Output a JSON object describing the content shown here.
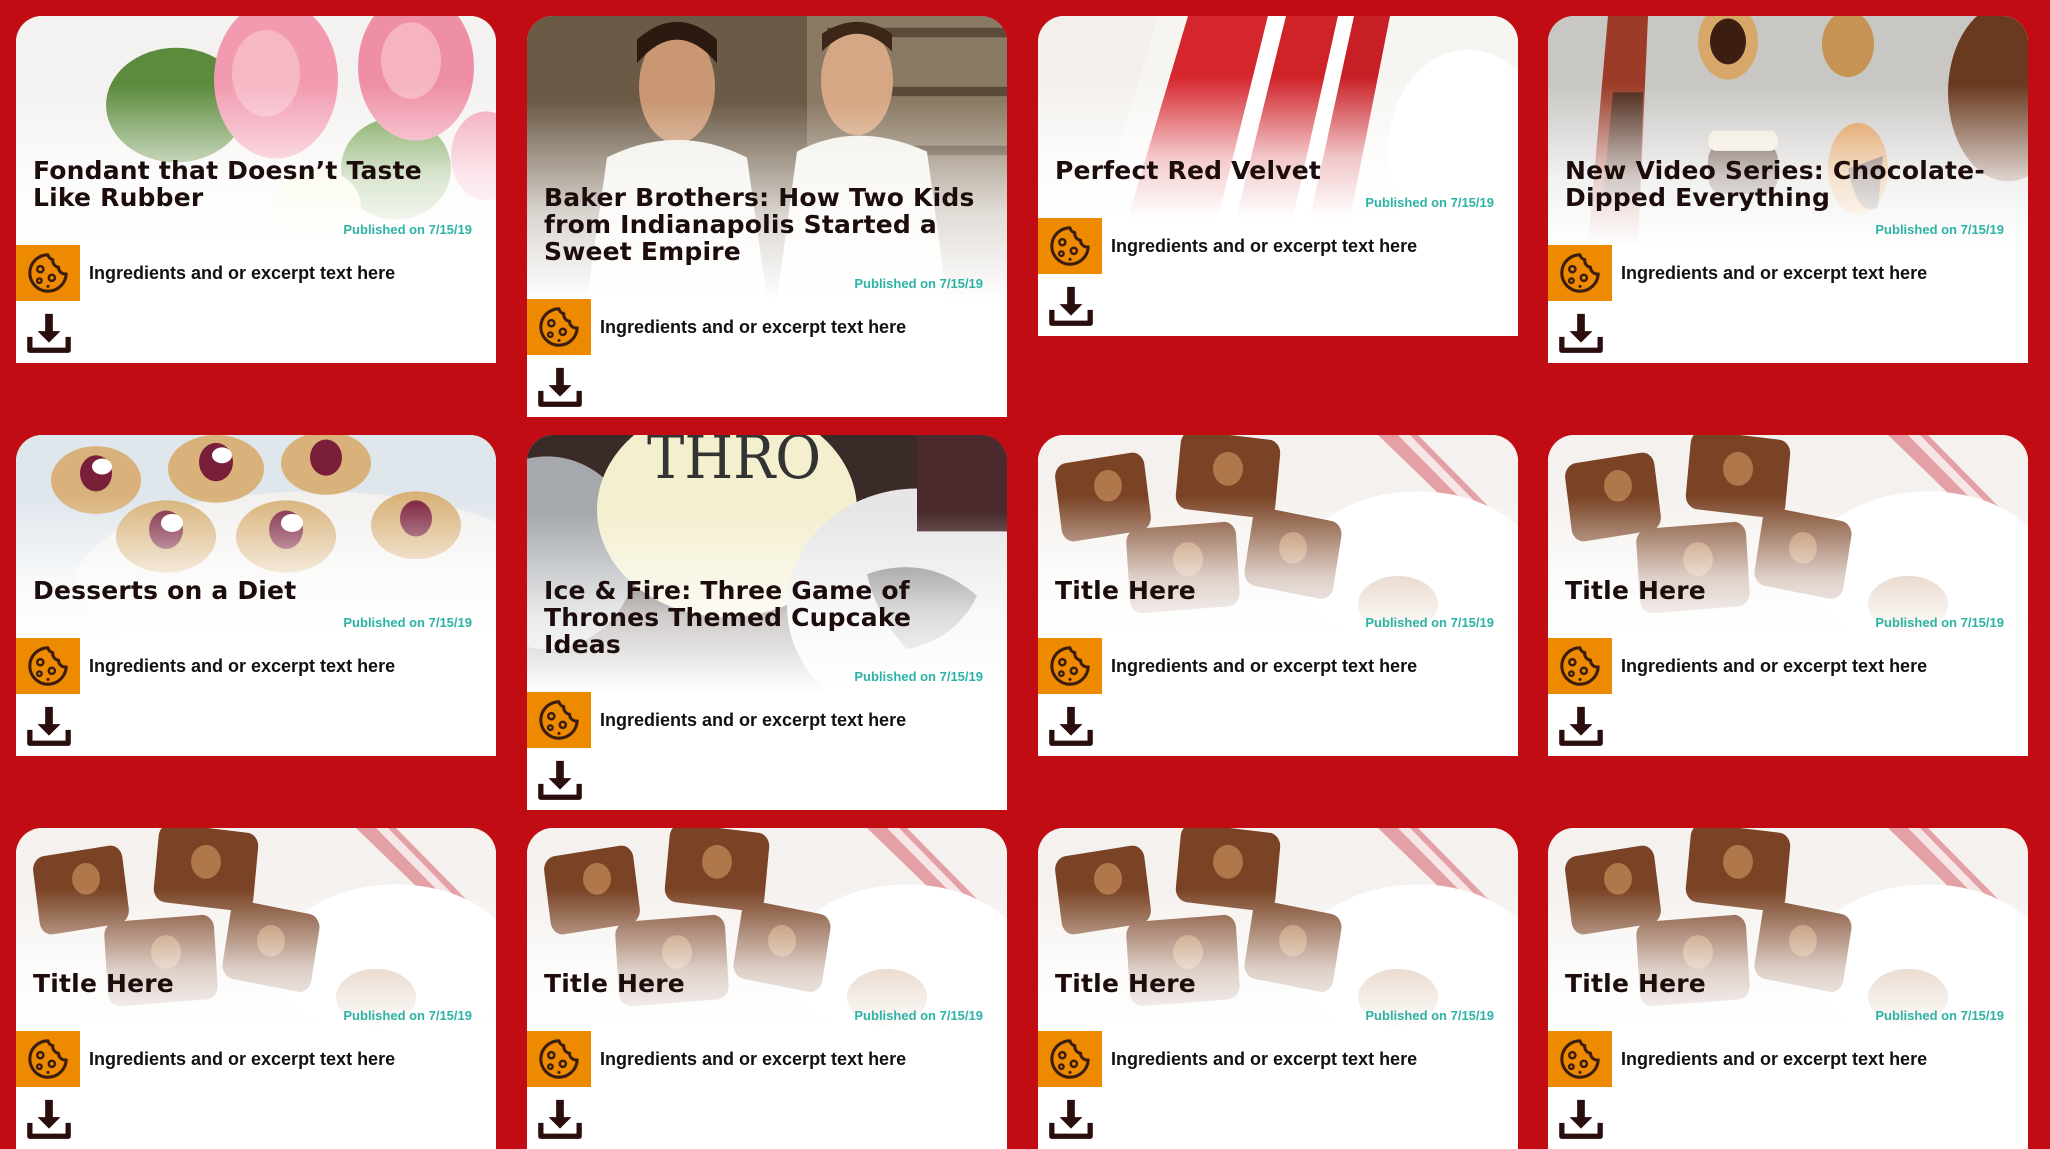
{
  "colors": {
    "background": "#c20c14",
    "accent": "#ee8a00",
    "date": "#2cb3a6",
    "title": "#1c0c0c"
  },
  "icons": {
    "excerpt": "cookie-icon",
    "download": "download-icon"
  },
  "cards": [
    {
      "title": "Fondant that Doesn’t Taste Like Rubber",
      "date": "Published on 7/15/19",
      "excerpt": "Ingredients and or excerpt text here",
      "image": "pink fondant roses"
    },
    {
      "title": "Baker Brothers: How Two Kids from Indianapolis Started a Sweet Empire",
      "date": "Published on 7/15/19",
      "excerpt": "Ingredients and or excerpt text here",
      "image": "two bakers in a bakery"
    },
    {
      "title": "Perfect Red Velvet",
      "date": "Published on 7/15/19",
      "excerpt": "Ingredients and or excerpt text here",
      "image": "red velvet cake slice"
    },
    {
      "title": "New Video Series: Chocolate-Dipped Everything",
      "date": "Published on 7/15/19",
      "excerpt": "Ingredients and or excerpt text here",
      "image": "chocolate dipped treats"
    },
    {
      "title": "Desserts on a Diet",
      "date": "Published on 7/15/19",
      "excerpt": "Ingredients and or excerpt text here",
      "image": "berry phyllo cups"
    },
    {
      "title": "Ice & Fire: Three Game of Thrones Themed Cupcake Ideas",
      "date": "Published on 7/15/19",
      "excerpt": "Ingredients and or excerpt text here",
      "image": "game of thrones cupcakes"
    },
    {
      "title": "Title Here",
      "date": "Published on 7/15/19",
      "excerpt": "Ingredients and or excerpt text here",
      "image": "fudge pieces"
    },
    {
      "title": "Title Here",
      "date": "Published on 7/15/19",
      "excerpt": "Ingredients and or excerpt text here",
      "image": "fudge pieces"
    },
    {
      "title": "Title Here",
      "date": "Published on 7/15/19",
      "excerpt": "Ingredients and or excerpt text here",
      "image": "fudge pieces"
    },
    {
      "title": "Title Here",
      "date": "Published on 7/15/19",
      "excerpt": "Ingredients and or excerpt text here",
      "image": "fudge pieces"
    },
    {
      "title": "Title Here",
      "date": "Published on 7/15/19",
      "excerpt": "Ingredients and or excerpt text here",
      "image": "fudge pieces"
    },
    {
      "title": "Title Here",
      "date": "Published on 7/15/19",
      "excerpt": "Ingredients and or excerpt text here",
      "image": "fudge pieces"
    }
  ]
}
